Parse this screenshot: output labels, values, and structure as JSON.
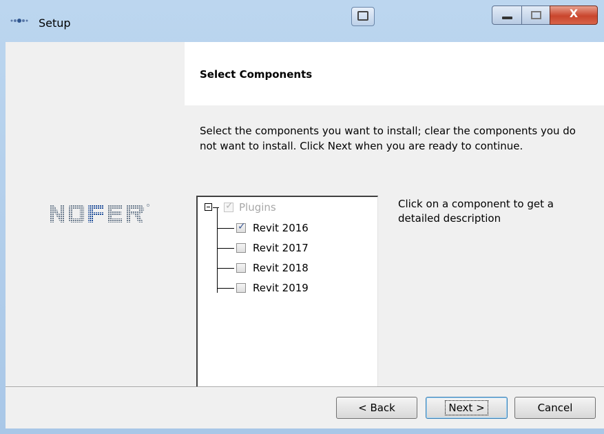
{
  "window": {
    "title": "Setup"
  },
  "header": {
    "title": "Select Components"
  },
  "description": "Select the components you want to install; clear the components you do not want to install. Click Next when you are ready to continue.",
  "logo": {
    "text": "NOFER"
  },
  "tree": {
    "root": {
      "label": "Plugins",
      "checked": true,
      "enabled": false
    },
    "items": [
      {
        "label": "Revit 2016",
        "checked": true
      },
      {
        "label": "Revit 2017",
        "checked": false
      },
      {
        "label": "Revit 2018",
        "checked": false
      },
      {
        "label": "Revit 2019",
        "checked": false
      }
    ]
  },
  "hint": "Click on a component to get a detailed description",
  "buttons": {
    "back": "< Back",
    "next": "Next >",
    "cancel": "Cancel"
  },
  "colors": {
    "accent": "#3d5a96",
    "frame": "#a9c7e7"
  },
  "icons": {
    "title_icon": "setup-app-icon",
    "check": "check-icon"
  }
}
